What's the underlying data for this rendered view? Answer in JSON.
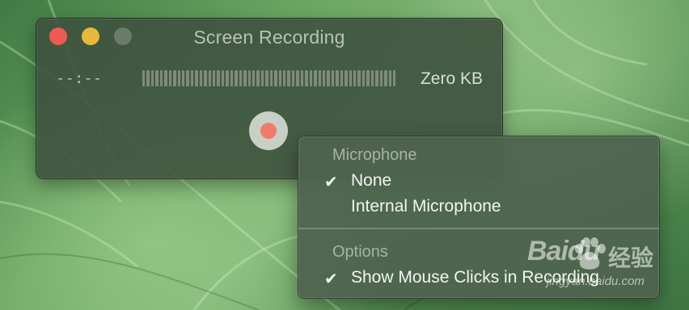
{
  "window": {
    "title": "Screen Recording",
    "elapsed_time": "--:--",
    "file_size": "Zero KB",
    "level_meter_bars": 58,
    "level_meter_value": 0
  },
  "menu": {
    "sections": [
      {
        "header": "Microphone",
        "items": [
          {
            "label": "None",
            "checked": true
          },
          {
            "label": "Internal Microphone",
            "checked": false
          }
        ]
      },
      {
        "header": "Options",
        "items": [
          {
            "label": "Show Mouse Clicks in Recording",
            "checked": true
          }
        ]
      }
    ],
    "check_glyph": "✔"
  },
  "watermark": {
    "logo": "Baidu",
    "cn_text": "经验",
    "url": "jingyan.baidu.com"
  },
  "colors": {
    "close": "#ee5b52",
    "minimize": "#e6b83d",
    "zoom": "#6b7a6a",
    "record_dot": "#ee7c6b"
  },
  "icons": {
    "close": "close-icon",
    "minimize": "minimize-icon",
    "zoom": "zoom-icon",
    "record": "record-icon",
    "check": "checkmark-icon",
    "paw": "baidu-paw-icon"
  }
}
